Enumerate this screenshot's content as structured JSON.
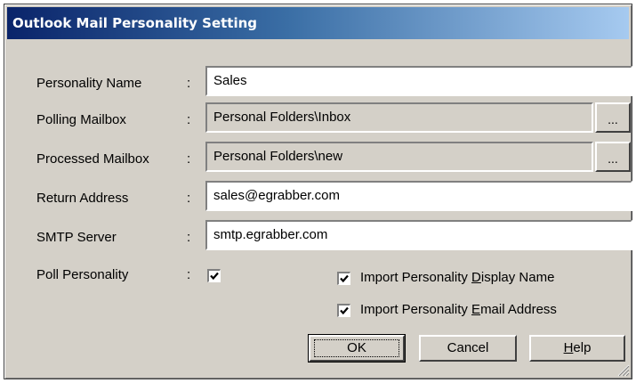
{
  "window": {
    "title": "Outlook Mail Personality Setting"
  },
  "fields": {
    "personality_name": {
      "label": "Personality Name",
      "value": "Sales"
    },
    "polling_mailbox": {
      "label": "Polling Mailbox",
      "value": "Personal Folders\\Inbox",
      "browse_label": "..."
    },
    "processed_mailbox": {
      "label": "Processed Mailbox",
      "value": "Personal Folders\\new",
      "browse_label": "..."
    },
    "return_address": {
      "label": "Return Address",
      "value": "sales@egrabber.com"
    },
    "smtp_server": {
      "label": "SMTP Server",
      "value": "smtp.egrabber.com"
    },
    "poll_personality": {
      "label": "Poll Personality",
      "checked": true
    }
  },
  "colon": ":",
  "checks": {
    "import_display_name": {
      "pre": "Import Personality ",
      "accel": "D",
      "post": "isplay Name",
      "checked": true
    },
    "import_email_address": {
      "pre": "Import Personality ",
      "accel": "E",
      "post": "mail Address",
      "checked": true
    }
  },
  "buttons": {
    "ok": {
      "label": "OK"
    },
    "cancel": {
      "label": "Cancel"
    },
    "help": {
      "accel": "H",
      "post": "elp"
    }
  },
  "colors": {
    "face": "#d4d0c8",
    "title_start": "#0a246a",
    "title_end": "#a6caf0"
  },
  "icons": {
    "check": "check-mark-icon",
    "grip": "resize-grip-icon"
  }
}
